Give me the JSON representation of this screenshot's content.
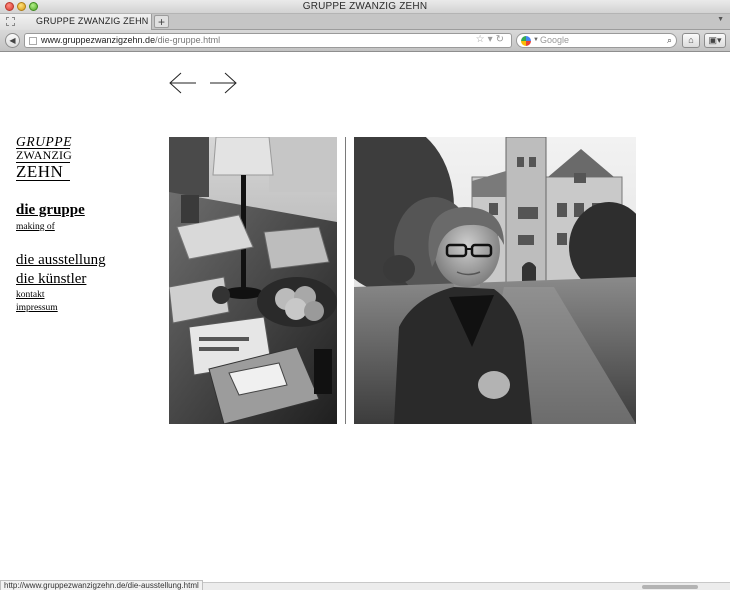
{
  "window": {
    "title": "GRUPPE ZWANZIG ZEHN"
  },
  "tabs": [
    {
      "label": "GRUPPE ZWANZIG ZEHN"
    }
  ],
  "new_tab_label": "+",
  "address_bar": {
    "url_host": "www.gruppezwanzigzehn.de",
    "url_path": "/die-gruppe.html"
  },
  "search_bar": {
    "placeholder": "Google"
  },
  "page": {
    "logo": {
      "line1": "GRUPPE",
      "line2": "ZWANZIG",
      "line3": "ZEHN"
    },
    "nav": {
      "die_gruppe": "die gruppe",
      "making_of": "making of",
      "die_ausstellung": "die ausstellung",
      "die_kuenstler": "die künstler",
      "kontakt": "kontakt",
      "impressum": "impressum"
    }
  },
  "status_bar": {
    "hover_url": "http://www.gruppezwanzigzehn.de/die-ausstellung.html"
  }
}
